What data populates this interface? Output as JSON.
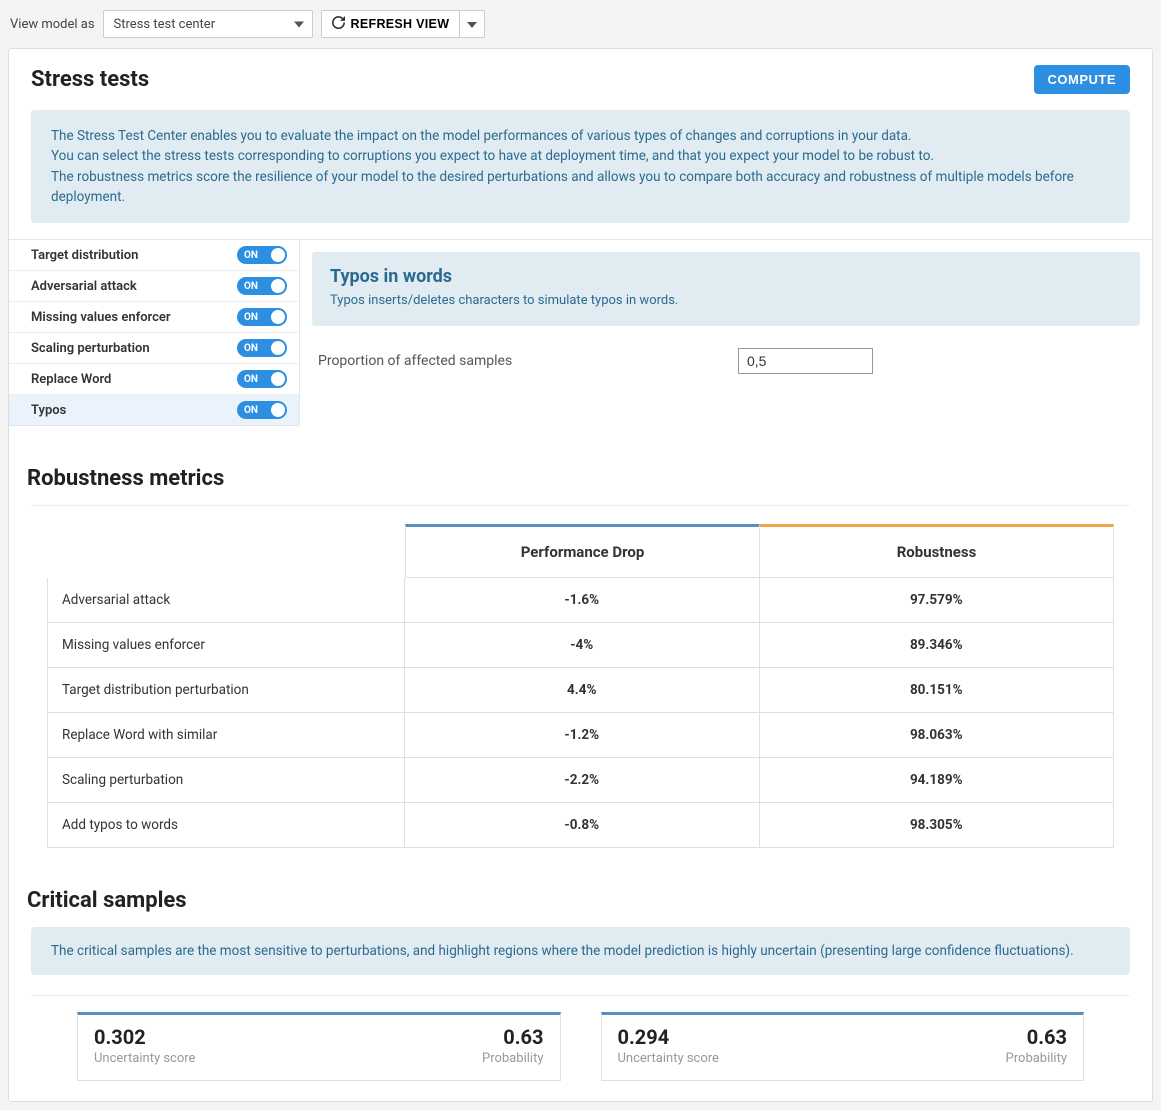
{
  "topbar": {
    "view_label": "View model as",
    "view_select": "Stress test center",
    "refresh_label": "REFRESH VIEW"
  },
  "stress": {
    "title": "Stress tests",
    "compute": "COMPUTE",
    "info1": "The Stress Test Center enables you to evaluate the impact on the model performances of various types of changes and corruptions in your data.",
    "info2": "You can select the stress tests corresponding to corruptions you expect to have at deployment time, and that you expect your model to be robust to.",
    "info3": "The robustness metrics score the resilience of your model to the desired perturbations and allows you to compare both accuracy and robustness of multiple models before deployment.",
    "toggle_on": "ON",
    "tests": [
      {
        "label": "Target distribution"
      },
      {
        "label": "Adversarial attack"
      },
      {
        "label": "Missing values enforcer"
      },
      {
        "label": "Scaling perturbation"
      },
      {
        "label": "Replace Word"
      },
      {
        "label": "Typos"
      }
    ],
    "detail": {
      "title": "Typos in words",
      "desc": "Typos inserts/deletes characters to simulate typos in words.",
      "param_label": "Proportion of affected samples",
      "param_value": "0,5"
    }
  },
  "metrics": {
    "title": "Robustness metrics",
    "col_perf": "Performance Drop",
    "col_rob": "Robustness",
    "rows": [
      {
        "label": "Adversarial attack",
        "perf": "-1.6%",
        "rob": "97.579%"
      },
      {
        "label": "Missing values enforcer",
        "perf": "-4%",
        "rob": "89.346%"
      },
      {
        "label": "Target distribution perturbation",
        "perf": "4.4%",
        "rob": "80.151%"
      },
      {
        "label": "Replace Word with similar",
        "perf": "-1.2%",
        "rob": "98.063%"
      },
      {
        "label": "Scaling perturbation",
        "perf": "-2.2%",
        "rob": "94.189%"
      },
      {
        "label": "Add typos to words",
        "perf": "-0.8%",
        "rob": "98.305%"
      }
    ]
  },
  "critical": {
    "title": "Critical samples",
    "desc": "The critical samples are the most sensitive to perturbations, and highlight regions where the model prediction is highly uncertain (presenting large confidence fluctuations).",
    "uncertainty_label": "Uncertainty score",
    "probability_label": "Probability",
    "cards": [
      {
        "uncertainty": "0.302",
        "probability": "0.63"
      },
      {
        "uncertainty": "0.294",
        "probability": "0.63"
      }
    ]
  }
}
